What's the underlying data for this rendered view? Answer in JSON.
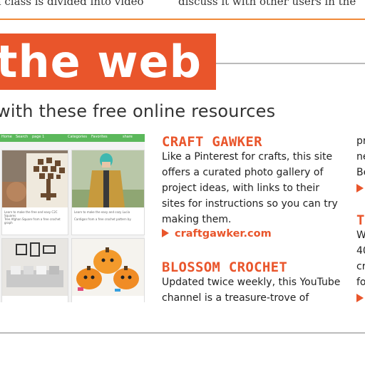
{
  "top": {
    "left_text": "n class is divided into video",
    "right_text": "discuss it with other users in the"
  },
  "banner": {
    "text": "n the web"
  },
  "subtitle": "with these free online resources",
  "screenshot": {
    "nav": [
      "Home",
      "Search",
      "page 1",
      "Categories",
      "Favorites",
      "share"
    ],
    "tiles": [
      {
        "caption_1": "Learn to make the free and easy C2C Squares",
        "caption_2": "Tree Afghan Square from a free crochet graph"
      },
      {
        "caption_1": "Learn to make the easy and cozy Lucia",
        "caption_2": "Cardigan from a free crochet pattern by"
      }
    ]
  },
  "articles": [
    {
      "heading": "CRAFT GAWKER",
      "lines": [
        "Like a Pinterest for crafts, this site",
        "offers a curated photo gallery of",
        "project ideas, with links to their",
        "sites for instructions so you can try",
        "making them."
      ],
      "link": "craftgawker.com"
    },
    {
      "heading": "BLOSSOM CROCHET",
      "lines": [
        "Updated twice weekly, this YouTube",
        "channel is a treasure-trove of"
      ]
    }
  ],
  "right_column": {
    "lines_top": [
      "pr",
      "ne",
      "Be"
    ],
    "heading_fragment": "TI",
    "lines_bottom": [
      "W",
      "40",
      "cr",
      "fo"
    ]
  },
  "colors": {
    "accent": "#e9552b",
    "rule_top": "#f08a3a",
    "green_bar": "#5bb85b"
  }
}
